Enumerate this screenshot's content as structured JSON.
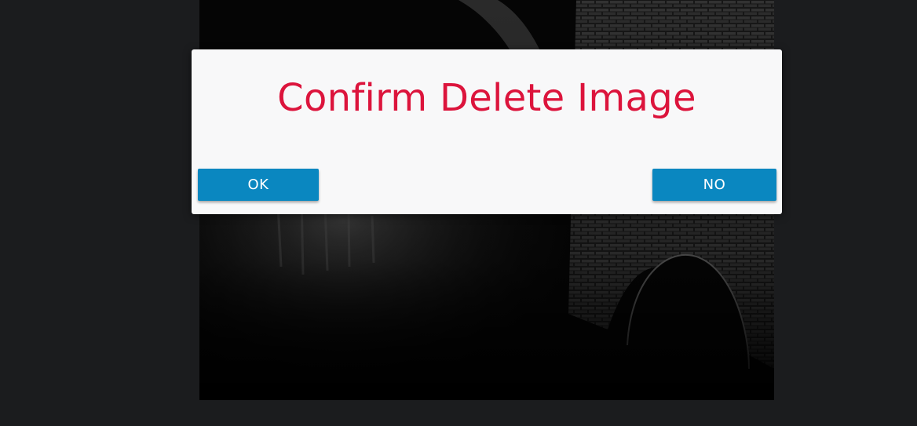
{
  "dialog": {
    "title": "Confirm Delete Image",
    "ok_label": "OK",
    "no_label": "NO"
  },
  "colors": {
    "page_background": "#1b1c1e",
    "dialog_background": "#f8f8f9",
    "title_color": "#dc143c",
    "button_color": "#0a87c0",
    "button_text": "#ffffff"
  }
}
